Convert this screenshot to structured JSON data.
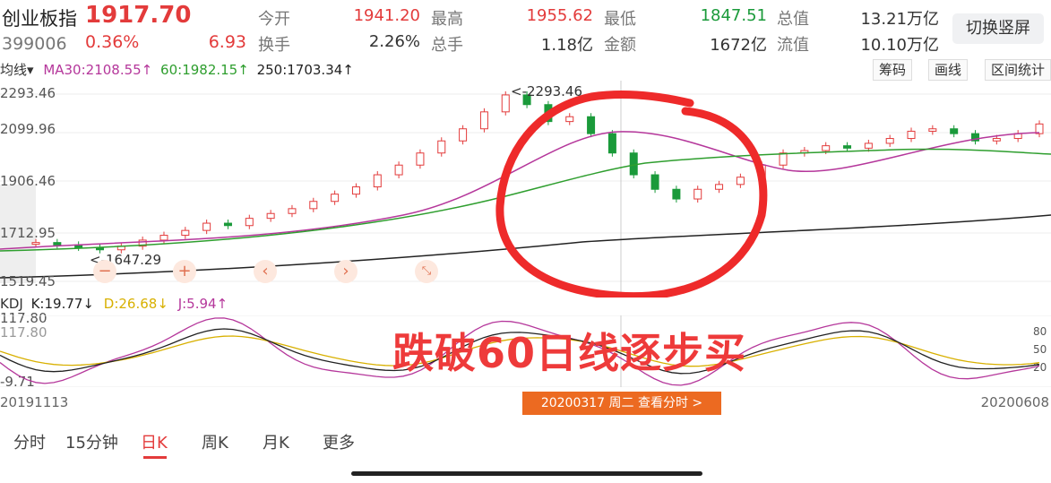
{
  "header": {
    "title": "创业板指",
    "price": "1917.70",
    "code": "399006",
    "change_pct": "0.36%",
    "change": "6.93",
    "open_label": "今开",
    "open": "1941.20",
    "high_label": "最高",
    "high": "1955.62",
    "low_label": "最低",
    "low": "1847.51",
    "total_label": "总值",
    "total": "13.21万亿",
    "turnover_label": "换手",
    "turnover": "2.26%",
    "vol_label": "总手",
    "vol": "1.18亿",
    "amount_label": "金额",
    "amount": "1672亿",
    "float_label": "流值",
    "float": "10.10万亿",
    "switch_label": "切换竖屏"
  },
  "ma": {
    "mode_label": "均线▾",
    "ma30": "MA30:2108.55↑",
    "ma60": "60:1982.15↑",
    "ma250": "250:1703.34↑"
  },
  "toolbar": {
    "chips": "筹码",
    "draw": "画线",
    "range": "区间统计"
  },
  "axis": {
    "y1": "2293.46",
    "y2": "2099.96",
    "y3": "1906.46",
    "y4": "1712.95",
    "y5": "1519.45",
    "max_marker": "<-2293.46",
    "min_marker": "<-1647.29"
  },
  "kdj": {
    "label": "KDJ",
    "k": "K:19.77↓",
    "d": "D:26.68↓",
    "j": "J:5.94↑",
    "top": "117.80",
    "top2": "117.80",
    "bottom": "-9.71",
    "r80": "80",
    "r50": "50",
    "r20": "20"
  },
  "dates": {
    "start": "20191113",
    "end": "20200608",
    "tooltip": "20200317 周二 查看分时 >"
  },
  "tabs": [
    "分时",
    "15分钟",
    "日K",
    "周K",
    "月K",
    "更多"
  ],
  "annotation": "跌破60日线逐步买",
  "chart_data": {
    "type": "candlestick",
    "title": "创业板指",
    "x_range": [
      "20191113",
      "20200608"
    ],
    "ylim": [
      1519.45,
      2293.46
    ],
    "series": [
      {
        "name": "MA30",
        "last": 2108.55
      },
      {
        "name": "60",
        "last": 1982.15
      },
      {
        "name": "250",
        "last": 1703.34
      }
    ],
    "close_points": [
      1680,
      1670,
      1660,
      1650,
      1665,
      1690,
      1710,
      1730,
      1760,
      1750,
      1780,
      1800,
      1820,
      1850,
      1880,
      1910,
      1960,
      2000,
      2050,
      2100,
      2150,
      2220,
      2290,
      2250,
      2180,
      2200,
      2130,
      2050,
      1960,
      1900,
      1860,
      1900,
      1920,
      1950,
      2000,
      2050,
      2060,
      2080,
      2070,
      2090,
      2110,
      2140,
      2150,
      2130,
      2100,
      2110,
      2130,
      2170
    ]
  },
  "colors": {
    "up": "#e33b3b",
    "down": "#1a9a3a",
    "ma30": "#b5379b",
    "ma60": "#2e9e2e",
    "ma250": "#222222",
    "accent": "#ec6a21"
  },
  "icons": {
    "zoom_out": "minus-icon",
    "zoom_in": "plus-icon",
    "left": "chevron-left-icon",
    "right": "chevron-right-icon",
    "collapse": "collapse-icon"
  }
}
